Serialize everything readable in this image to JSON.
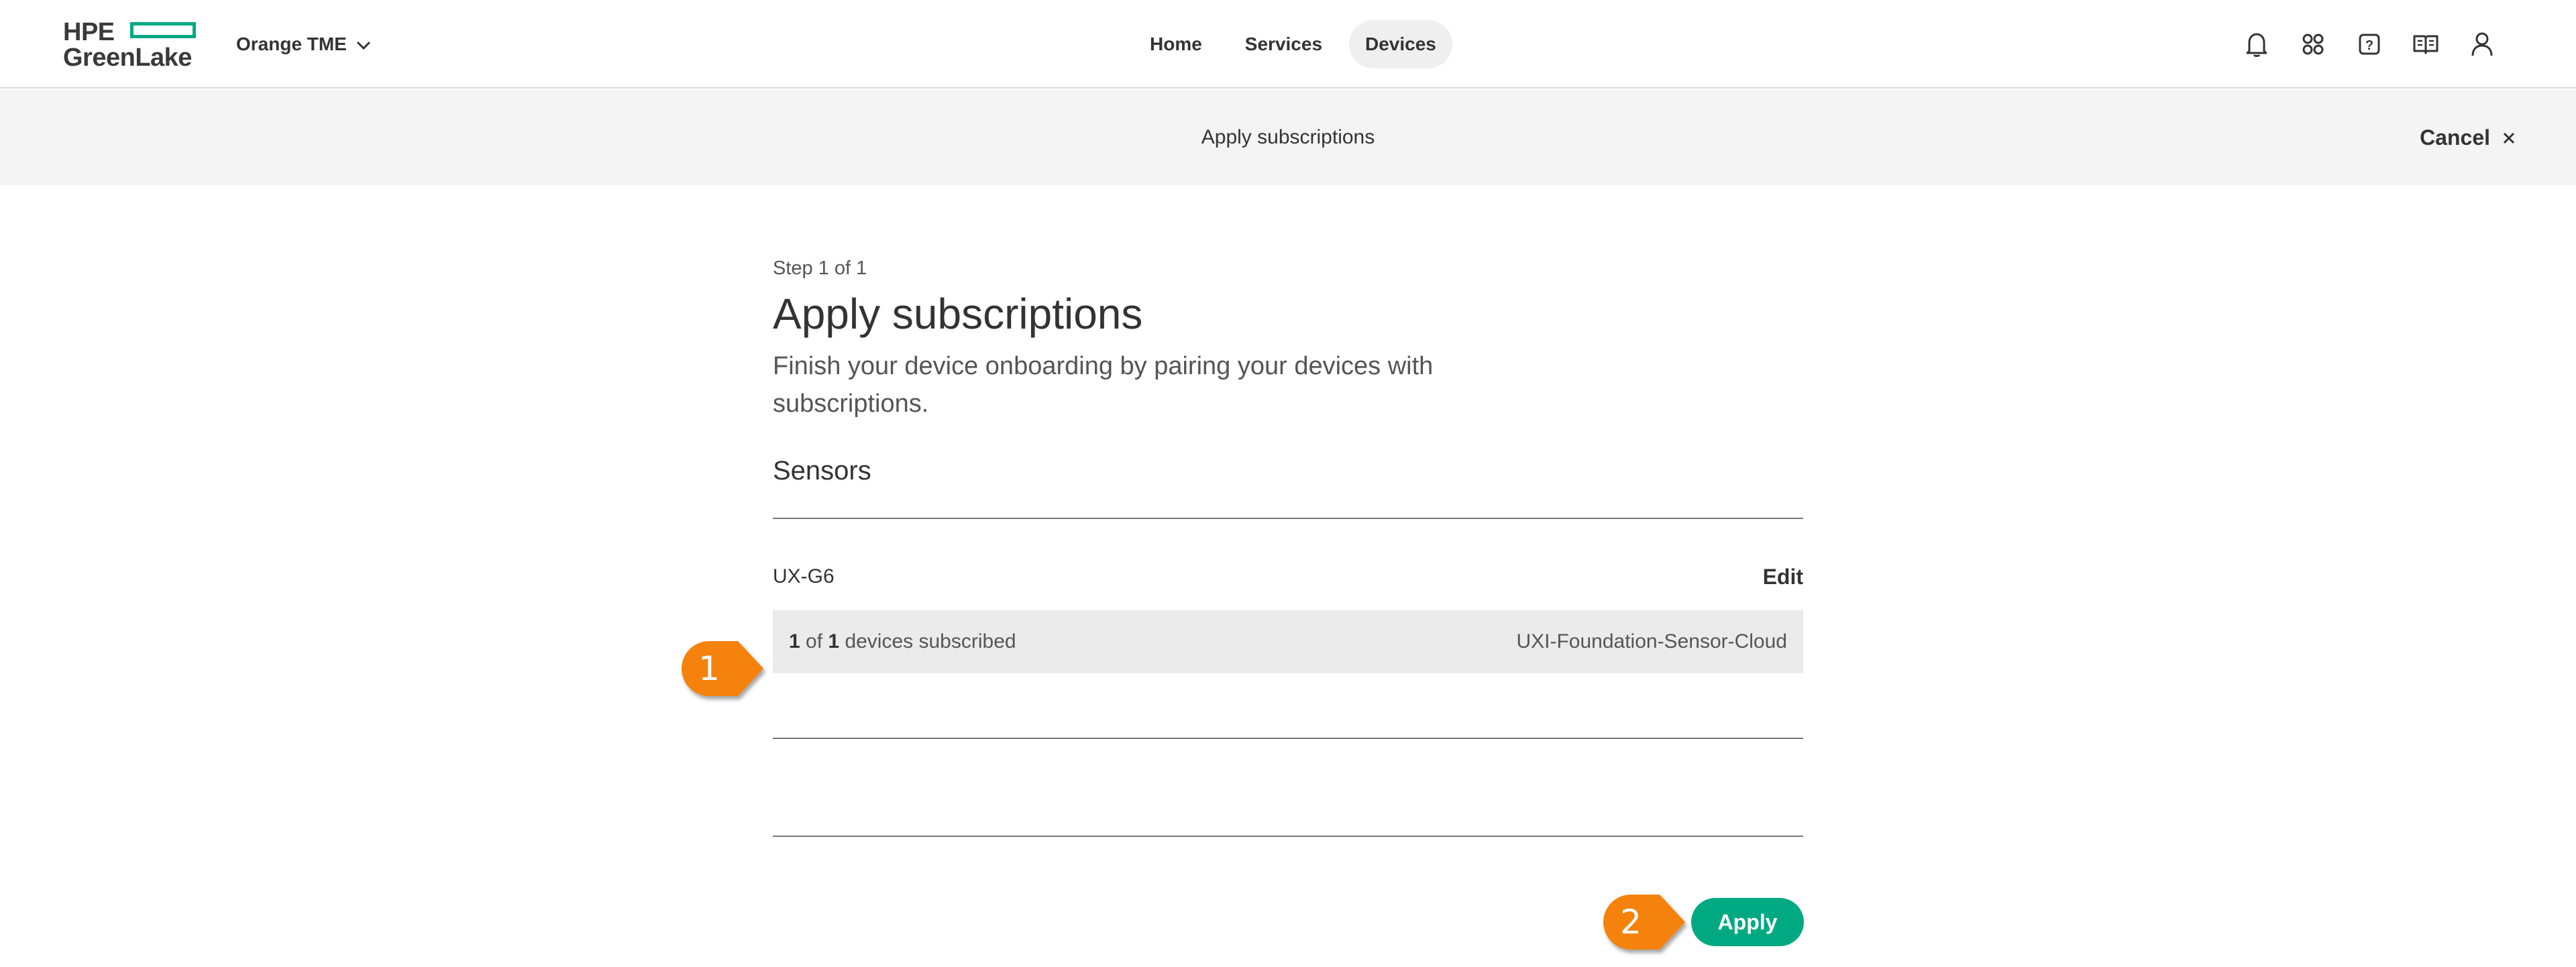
{
  "header": {
    "logo_top": "HPE",
    "logo_bottom": "GreenLake",
    "workspace_name": "Orange TME",
    "nav": [
      {
        "label": "Home",
        "active": false
      },
      {
        "label": "Services",
        "active": false
      },
      {
        "label": "Devices",
        "active": true
      }
    ],
    "icons": [
      "bell-icon",
      "apps-grid-icon",
      "help-icon",
      "book-icon",
      "user-icon"
    ]
  },
  "subheader": {
    "title": "Apply subscriptions",
    "cancel_label": "Cancel"
  },
  "main": {
    "step": "Step 1 of 1",
    "title": "Apply subscriptions",
    "description": "Finish your device onboarding by pairing your devices with subscriptions.",
    "section_title": "Sensors",
    "device_model": "UX-G6",
    "edit_label": "Edit",
    "subscribed_count": "1",
    "of_label": "of",
    "total_count": "1",
    "subscribed_suffix": "devices subscribed",
    "subscription_name": "UXI-Foundation-Sensor-Cloud",
    "apply_label": "Apply"
  },
  "callouts": [
    {
      "number": "1"
    },
    {
      "number": "2"
    }
  ],
  "colors": {
    "brand_green": "#01a982",
    "callout_orange": "#f5820f",
    "subbar_bg": "#f4f4f4",
    "row_bg": "#ebebeb"
  }
}
